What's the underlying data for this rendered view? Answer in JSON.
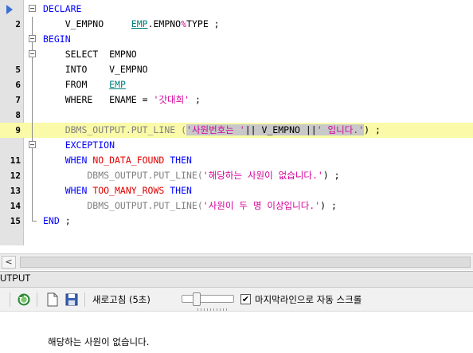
{
  "editor": {
    "lines": [
      {
        "num": "",
        "fold": "minus",
        "arrow": true,
        "parts": [
          {
            "t": "DECLARE",
            "c": "kw"
          }
        ]
      },
      {
        "num": "2",
        "fold": "vl",
        "parts": [
          {
            "t": "    V_EMPNO     ",
            "c": "pl"
          },
          {
            "t": "EMP",
            "c": "obj"
          },
          {
            "t": ".EMPNO",
            "c": "pl"
          },
          {
            "t": "%",
            "c": "pct"
          },
          {
            "t": "TYPE ;",
            "c": "pl"
          }
        ]
      },
      {
        "num": "",
        "fold": "minus",
        "parts": [
          {
            "t": "BEGIN",
            "c": "kw"
          }
        ]
      },
      {
        "num": "",
        "fold": "minus",
        "parts": [
          {
            "t": "    SELECT  EMPNO",
            "c": "pl"
          }
        ]
      },
      {
        "num": "5",
        "fold": "vl",
        "parts": [
          {
            "t": "    INTO    V_EMPNO",
            "c": "pl"
          }
        ]
      },
      {
        "num": "6",
        "fold": "vl",
        "parts": [
          {
            "t": "    FROM    ",
            "c": "pl"
          },
          {
            "t": "EMP",
            "c": "obj"
          }
        ]
      },
      {
        "num": "7",
        "fold": "vl",
        "parts": [
          {
            "t": "    WHERE   ENAME = ",
            "c": "pl"
          },
          {
            "t": "'갓대희'",
            "c": "str"
          },
          {
            "t": " ;",
            "c": "pl"
          }
        ]
      },
      {
        "num": "8",
        "fold": "vl",
        "parts": []
      },
      {
        "num": "9",
        "fold": "vl",
        "hl": true,
        "parts": [
          {
            "t": "    DBMS_OUTPUT.PUT_LINE (",
            "c": "gray"
          },
          {
            "t": "'사원번호는 '",
            "c": "str hlbox"
          },
          {
            "t": "|| V_EMPNO ||",
            "c": "pl hlbox"
          },
          {
            "t": "' 입니다.'",
            "c": "str hlbox"
          },
          {
            "t": ") ;",
            "c": "pl"
          }
        ]
      },
      {
        "num": "",
        "fold": "minus",
        "parts": [
          {
            "t": "    EXCEPTION",
            "c": "kw"
          }
        ]
      },
      {
        "num": "11",
        "fold": "vl",
        "parts": [
          {
            "t": "    WHEN ",
            "c": "kw"
          },
          {
            "t": "NO_DATA_FOUND",
            "c": "err"
          },
          {
            "t": " THEN",
            "c": "kw"
          }
        ]
      },
      {
        "num": "12",
        "fold": "vl",
        "parts": [
          {
            "t": "        DBMS_OUTPUT.PUT_LINE(",
            "c": "gray"
          },
          {
            "t": "'해당하는 사원이 없습니다.'",
            "c": "str"
          },
          {
            "t": ") ;",
            "c": "pl"
          }
        ]
      },
      {
        "num": "13",
        "fold": "vl",
        "parts": [
          {
            "t": "    WHEN ",
            "c": "kw"
          },
          {
            "t": "TOO_MANY_ROWS",
            "c": "err"
          },
          {
            "t": " THEN",
            "c": "kw"
          }
        ]
      },
      {
        "num": "14",
        "fold": "vl",
        "parts": [
          {
            "t": "        DBMS_OUTPUT.PUT_LINE(",
            "c": "gray"
          },
          {
            "t": "'사원이 두 명 이상입니다.'",
            "c": "str"
          },
          {
            "t": ") ;",
            "c": "pl"
          }
        ]
      },
      {
        "num": "15",
        "fold": "end",
        "parts": [
          {
            "t": "END",
            "c": "kw"
          },
          {
            "t": " ;",
            "c": "pl"
          }
        ]
      }
    ]
  },
  "scrollbar": {
    "left_arrow": "<"
  },
  "output_panel": {
    "header": "UTPUT",
    "refresh_label": "새로고침 (5초)",
    "autoscroll_checked": "✔",
    "autoscroll_label": "마지막라인으로 자동 스크롤",
    "message": "해당하는 사원이 없습니다."
  },
  "colors": {
    "keyword": "#0000ff",
    "string": "#d4009a",
    "object": "#008080",
    "exception": "#e00000",
    "highlight": "#fafaa8"
  }
}
